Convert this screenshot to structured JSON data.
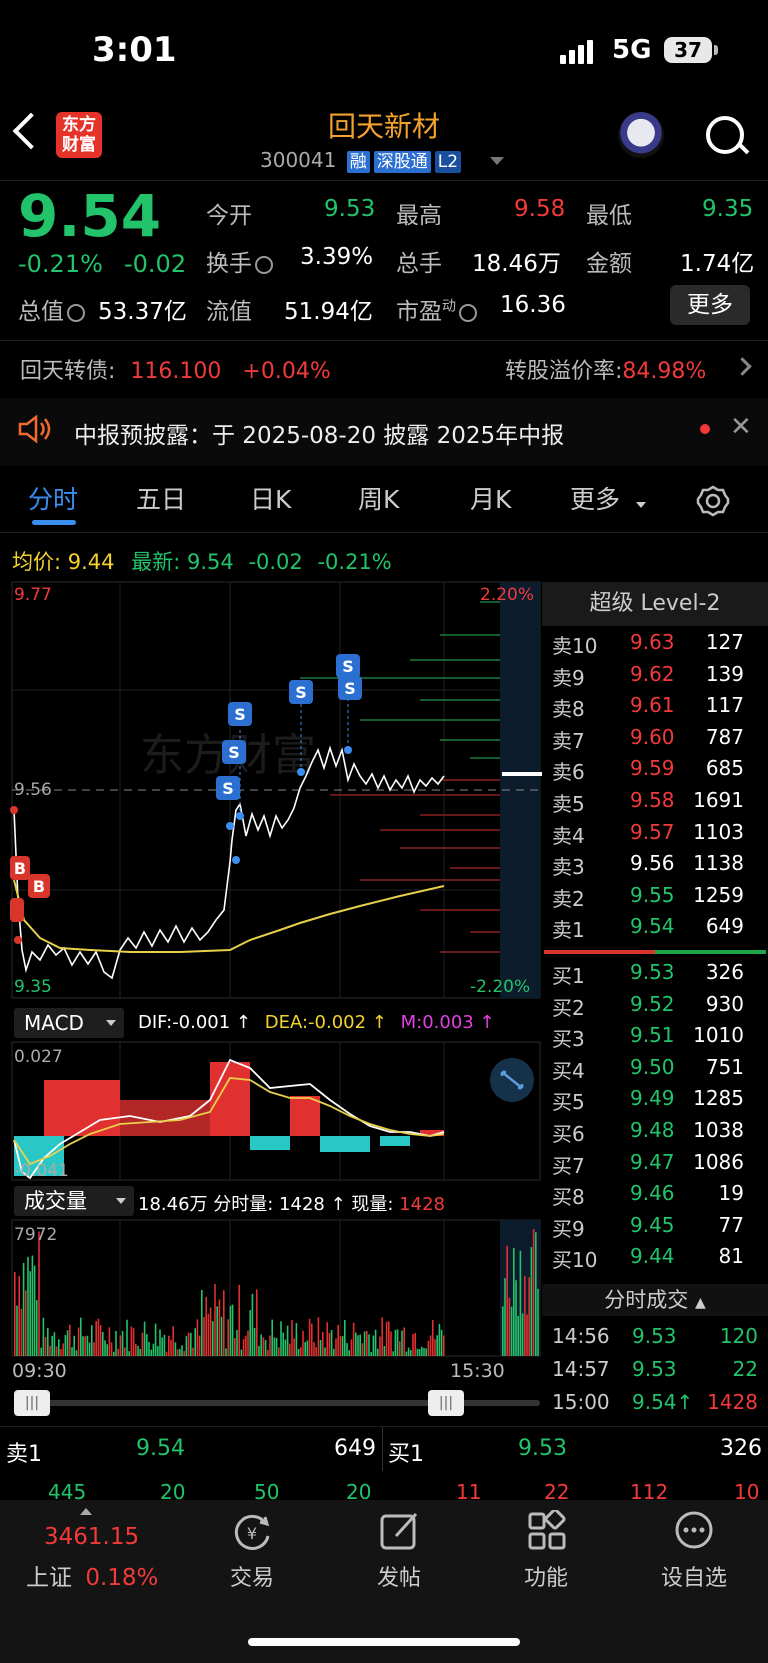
{
  "status": {
    "time": "3:01",
    "network": "5G",
    "battery": "37"
  },
  "header": {
    "logo_line1": "东方",
    "logo_line2": "财富",
    "stock_name": "回天新材",
    "stock_code": "300041",
    "tags": [
      "融",
      "深股通",
      "L2"
    ]
  },
  "quote": {
    "price": "9.54",
    "change_pct": "-0.21%",
    "change": "-0.02",
    "open_label": "今开",
    "open": "9.53",
    "high_label": "最高",
    "high": "9.58",
    "low_label": "最低",
    "low": "9.35",
    "turnover_label": "换手",
    "turnover": "3.39%",
    "volume_label": "总手",
    "volume": "18.46万",
    "amount_label": "金额",
    "amount": "1.74亿",
    "mktcap_label": "总值",
    "mktcap": "53.37亿",
    "float_label": "流值",
    "float": "51.94亿",
    "pe_label": "市盈",
    "pe_sup": "动",
    "pe": "16.36",
    "more": "更多"
  },
  "bond": {
    "name": "回天转债:",
    "price": "116.100",
    "change": "+0.04%",
    "premium_label": "转股溢价率:",
    "premium": "84.98%"
  },
  "banner": {
    "text": "中报预披露：于 2025-08-20 披露 2025年中报"
  },
  "tabs": [
    "分时",
    "五日",
    "日K",
    "周K",
    "月K",
    "更多"
  ],
  "avgline": {
    "avg_label": "均价:",
    "avg": "9.44",
    "latest_label": "最新:",
    "latest": "9.54",
    "chg": "-0.02",
    "pct": "-0.21%"
  },
  "chart": {
    "y_top": "9.77",
    "y_mid": "9.56",
    "y_bot": "9.35",
    "pct_top": "2.20%",
    "pct_bot": "-2.20%",
    "watermark": "东方财富",
    "macd_label": "MACD",
    "dif": "DIF:-0.001 ↑",
    "dea": "DEA:-0.002 ↑",
    "m": "M:0.003 ↑",
    "macd_top": "0.027",
    "macd_bot": "-0.041",
    "vol_label": "成交量",
    "vol_info": "18.46万 分时量: 1428 ↑ 现量:",
    "vol_now": "1428",
    "vol_max": "7972",
    "time_start": "09:30",
    "time_end": "15:30",
    "buy_marker": "B",
    "sell_marker": "S"
  },
  "orderbook": {
    "title": "超级 Level-2",
    "asks": [
      {
        "l": "卖10",
        "p": "9.63",
        "v": "127"
      },
      {
        "l": "卖9",
        "p": "9.62",
        "v": "139"
      },
      {
        "l": "卖8",
        "p": "9.61",
        "v": "117"
      },
      {
        "l": "卖7",
        "p": "9.60",
        "v": "787"
      },
      {
        "l": "卖6",
        "p": "9.59",
        "v": "685"
      },
      {
        "l": "卖5",
        "p": "9.58",
        "v": "1691"
      },
      {
        "l": "卖4",
        "p": "9.57",
        "v": "1103"
      },
      {
        "l": "卖3",
        "p": "9.56",
        "v": "1138"
      },
      {
        "l": "卖2",
        "p": "9.55",
        "v": "1259"
      },
      {
        "l": "卖1",
        "p": "9.54",
        "v": "649"
      }
    ],
    "bids": [
      {
        "l": "买1",
        "p": "9.53",
        "v": "326"
      },
      {
        "l": "买2",
        "p": "9.52",
        "v": "930"
      },
      {
        "l": "买3",
        "p": "9.51",
        "v": "1010"
      },
      {
        "l": "买4",
        "p": "9.50",
        "v": "751"
      },
      {
        "l": "买5",
        "p": "9.49",
        "v": "1285"
      },
      {
        "l": "买6",
        "p": "9.48",
        "v": "1038"
      },
      {
        "l": "买7",
        "p": "9.47",
        "v": "1086"
      },
      {
        "l": "买8",
        "p": "9.46",
        "v": "19"
      },
      {
        "l": "买9",
        "p": "9.45",
        "v": "77"
      },
      {
        "l": "买10",
        "p": "9.44",
        "v": "81"
      }
    ],
    "ticks_title": "分时成交",
    "ticks": [
      {
        "t": "14:56",
        "p": "9.53",
        "v": "120"
      },
      {
        "t": "14:57",
        "p": "9.53",
        "v": "22"
      },
      {
        "t": "15:00",
        "p": "9.54↑",
        "v": "1428"
      }
    ]
  },
  "level1": {
    "ask_label": "卖1",
    "ask_p": "9.54",
    "ask_v": "649",
    "bid_label": "买1",
    "bid_p": "9.53",
    "bid_v": "326",
    "row2_left": [
      "445",
      "20",
      "50",
      "20"
    ],
    "row2_right": [
      "11",
      "22",
      "112",
      "10"
    ]
  },
  "bottom": {
    "index_value": "3461.15",
    "index_name": "上证",
    "index_pct": "0.18%",
    "tabs": [
      "交易",
      "发帖",
      "功能",
      "设自选"
    ]
  }
}
